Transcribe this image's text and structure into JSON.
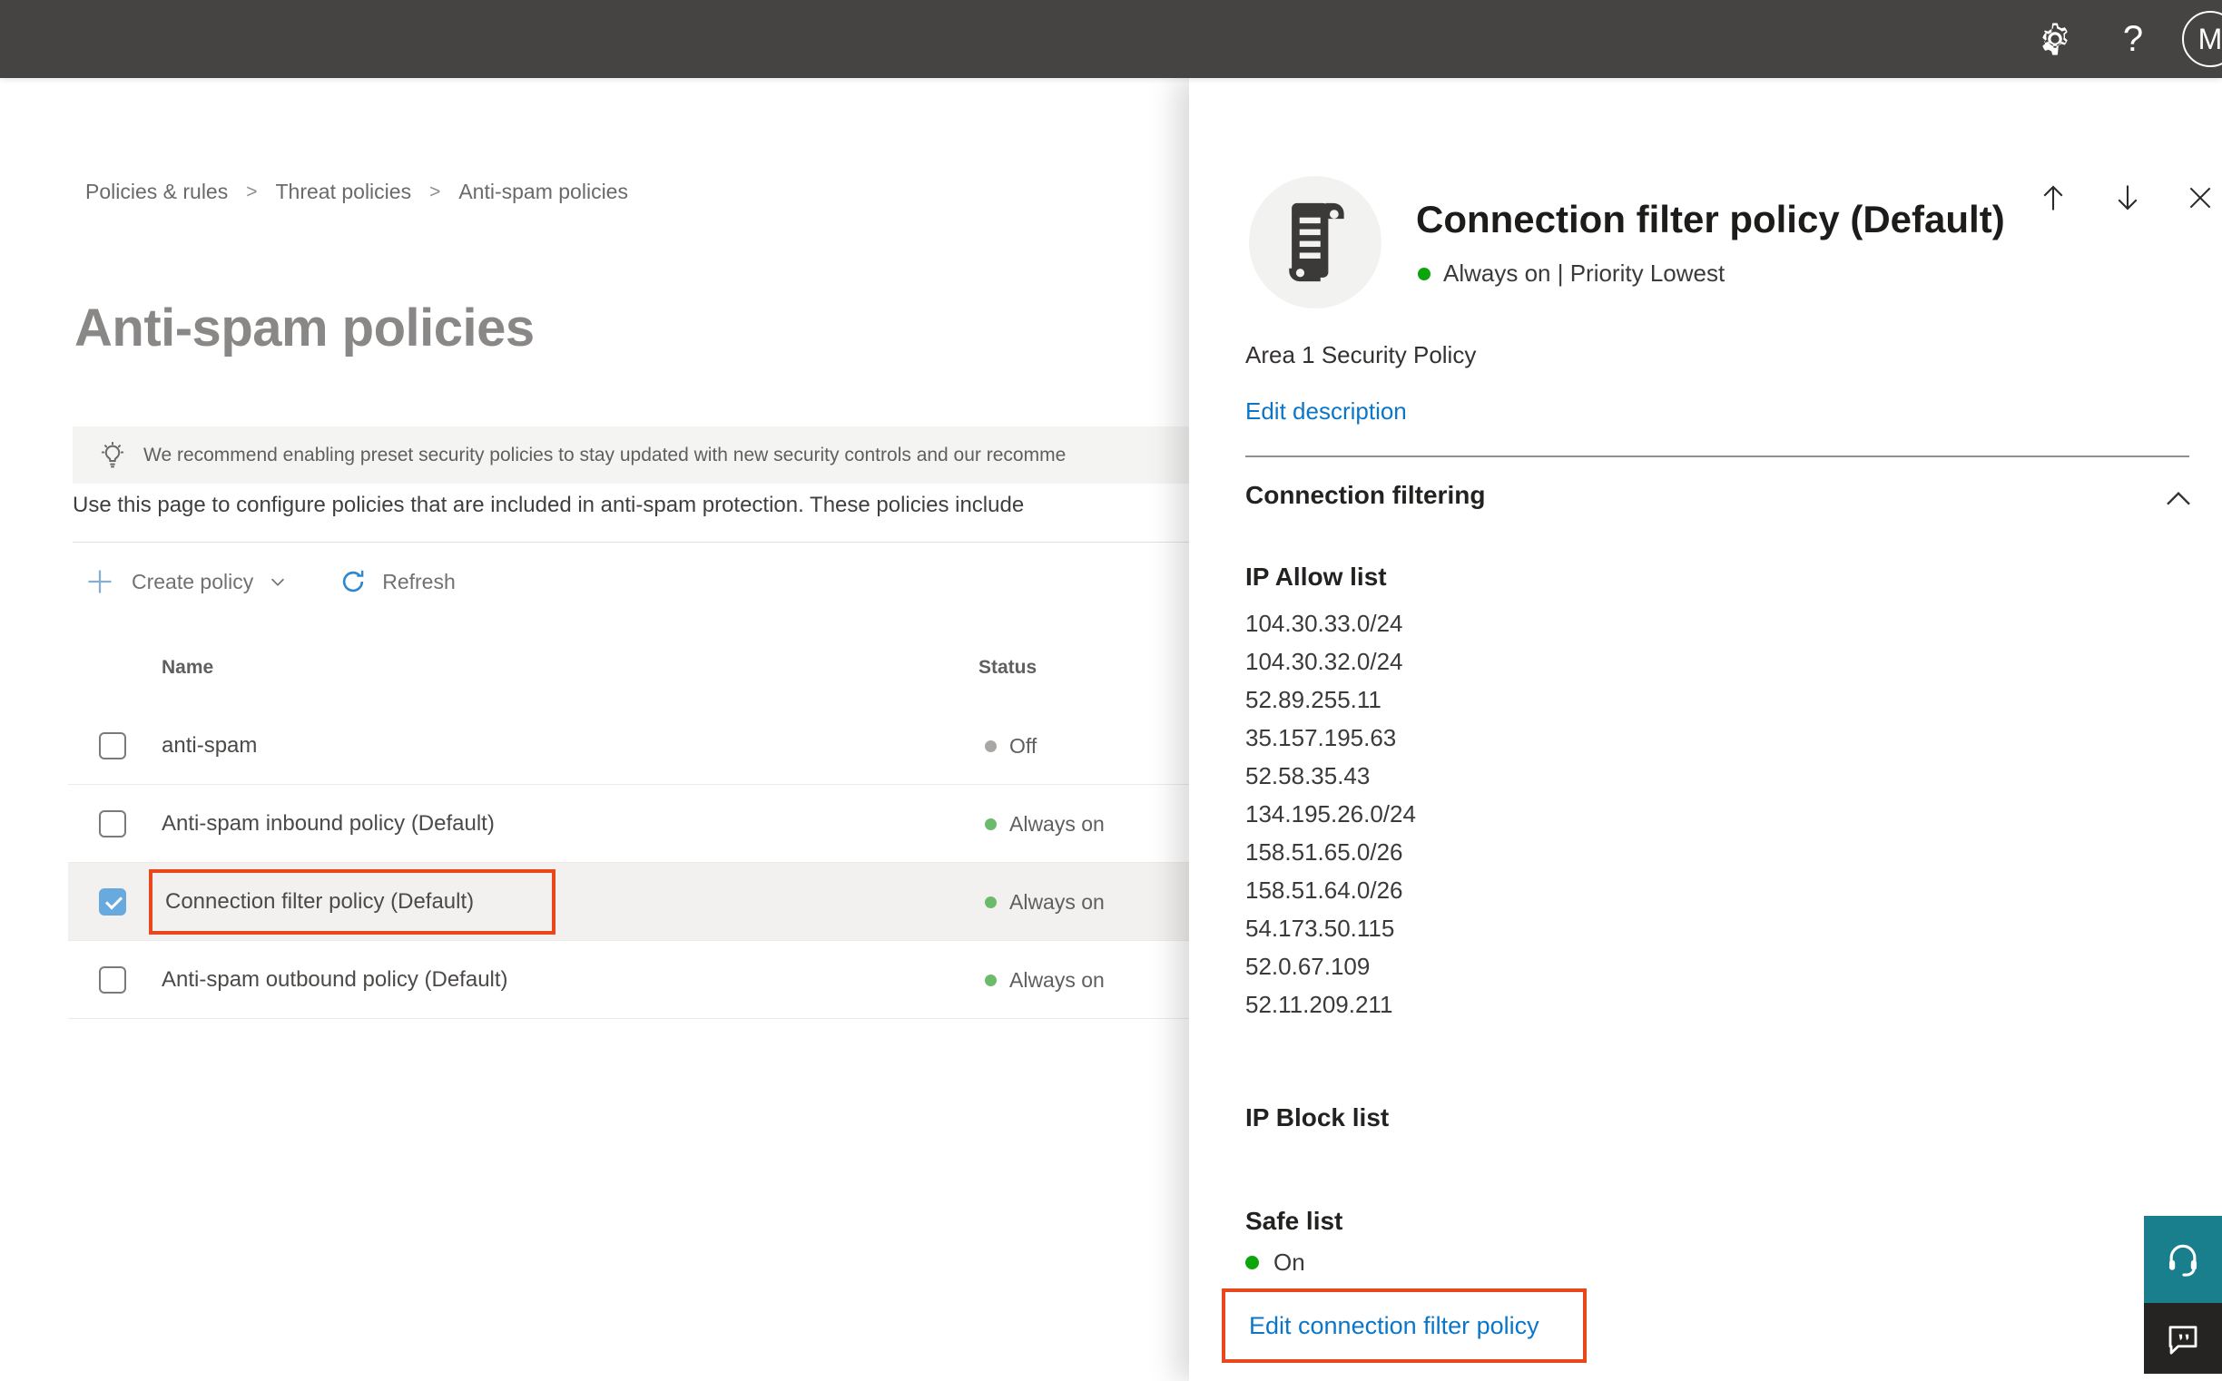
{
  "topbar": {
    "help_label": "?",
    "avatar_initial": "M"
  },
  "breadcrumb": {
    "separator": ">",
    "items": [
      "Policies & rules",
      "Threat policies",
      "Anti-spam policies"
    ]
  },
  "page": {
    "title": "Anti-spam policies",
    "banner_text": "We recommend enabling preset security policies to stay updated with new security controls and our recomme",
    "description": "Use this page to configure policies that are included in anti-spam protection. These policies include",
    "toolbar": {
      "create_label": "Create policy",
      "refresh_label": "Refresh"
    },
    "table": {
      "columns": [
        "Name",
        "Status"
      ],
      "rows": [
        {
          "name": "anti-spam",
          "status": "Off"
        },
        {
          "name": "Anti-spam inbound policy (Default)",
          "status": "Always on"
        },
        {
          "name": "Connection filter policy (Default)",
          "status": "Always on"
        },
        {
          "name": "Anti-spam outbound policy (Default)",
          "status": "Always on"
        }
      ]
    }
  },
  "panel": {
    "title": "Connection filter policy (Default)",
    "status_line": "Always on | Priority Lowest",
    "description": "Area 1 Security Policy",
    "edit_description_label": "Edit description",
    "section_connection_filtering": "Connection filtering",
    "ip_allow_title": "IP Allow list",
    "ip_allow_list": [
      "104.30.33.0/24",
      "104.30.32.0/24",
      "52.89.255.11",
      "35.157.195.63",
      "52.58.35.43",
      "134.195.26.0/24",
      "158.51.65.0/26",
      "158.51.64.0/26",
      "54.173.50.115",
      "52.0.67.109",
      "52.11.209.211"
    ],
    "ip_block_title": "IP Block list",
    "safe_list_title": "Safe list",
    "safe_list_status": "On",
    "edit_link_label": "Edit connection filter policy"
  },
  "colors": {
    "accent_blue": "#0b76c8",
    "checkbox_blue": "#69aade",
    "status_green_table": "#6cbb6c",
    "status_green_panel": "#0ca50c",
    "status_gray": "#a9a7a5",
    "annotation_red": "#e8481c",
    "topbar_bg": "#454442",
    "support_teal": "#1a7f8c",
    "feedback_dark": "#262422"
  }
}
